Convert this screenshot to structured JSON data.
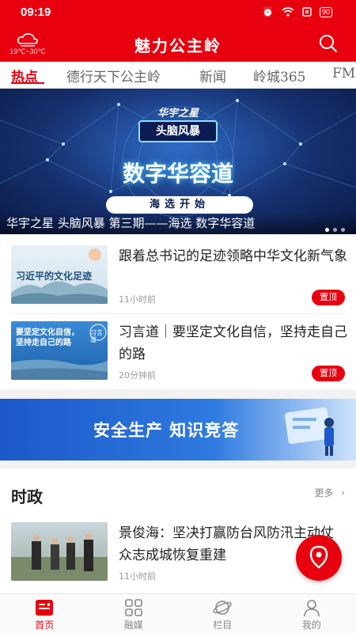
{
  "status": {
    "time": "09:19",
    "battery": "90"
  },
  "header": {
    "title": "魅力公主岭",
    "temperature": "19℃~30℃"
  },
  "tabs": [
    {
      "label": "热点",
      "active": true
    },
    {
      "label": "德行天下公主岭",
      "active": false
    },
    {
      "label": "新闻",
      "active": false
    },
    {
      "label": "岭城365",
      "active": false
    },
    {
      "label": "FM",
      "active": false
    }
  ],
  "banner": {
    "logo_line1": "华宇之星",
    "logo_line2": "头脑风暴",
    "headline": "数字华容道",
    "pill": "海选开始",
    "caption": "华宇之星 头脑风暴 第三期——海选 数字华容道",
    "slide_count": 3,
    "active_slide": 1
  },
  "news": [
    {
      "thumb_text": "习近平的文化足迹",
      "headline": "跟着总书记的足迹领略中华文化新气象",
      "time": "11小时前",
      "tag": "置顶"
    },
    {
      "thumb_text": "要坚定文化自信，坚持走自己的路",
      "thumb_badge": "习言道",
      "headline": "习言道｜要坚定文化自信，坚持走自己的路",
      "time": "20分钟前",
      "tag": "置顶"
    }
  ],
  "ad": {
    "text": "安全生产 知识竞答"
  },
  "section": {
    "title": "时政",
    "more": "更多",
    "item": {
      "headline": "景俊海：坚决打赢防台风防汛主动仗 众志成城恢复重建",
      "time": "11小时前"
    }
  },
  "bottom_nav": [
    {
      "label": "首页",
      "icon": "home-news-icon",
      "active": true
    },
    {
      "label": "融媒",
      "icon": "grid-icon",
      "active": false
    },
    {
      "label": "栏目",
      "icon": "planet-icon",
      "active": false
    },
    {
      "label": "我的",
      "icon": "user-icon",
      "active": false
    }
  ],
  "colors": {
    "brand": "#e8000f",
    "text": "#222222",
    "muted": "#999999"
  }
}
